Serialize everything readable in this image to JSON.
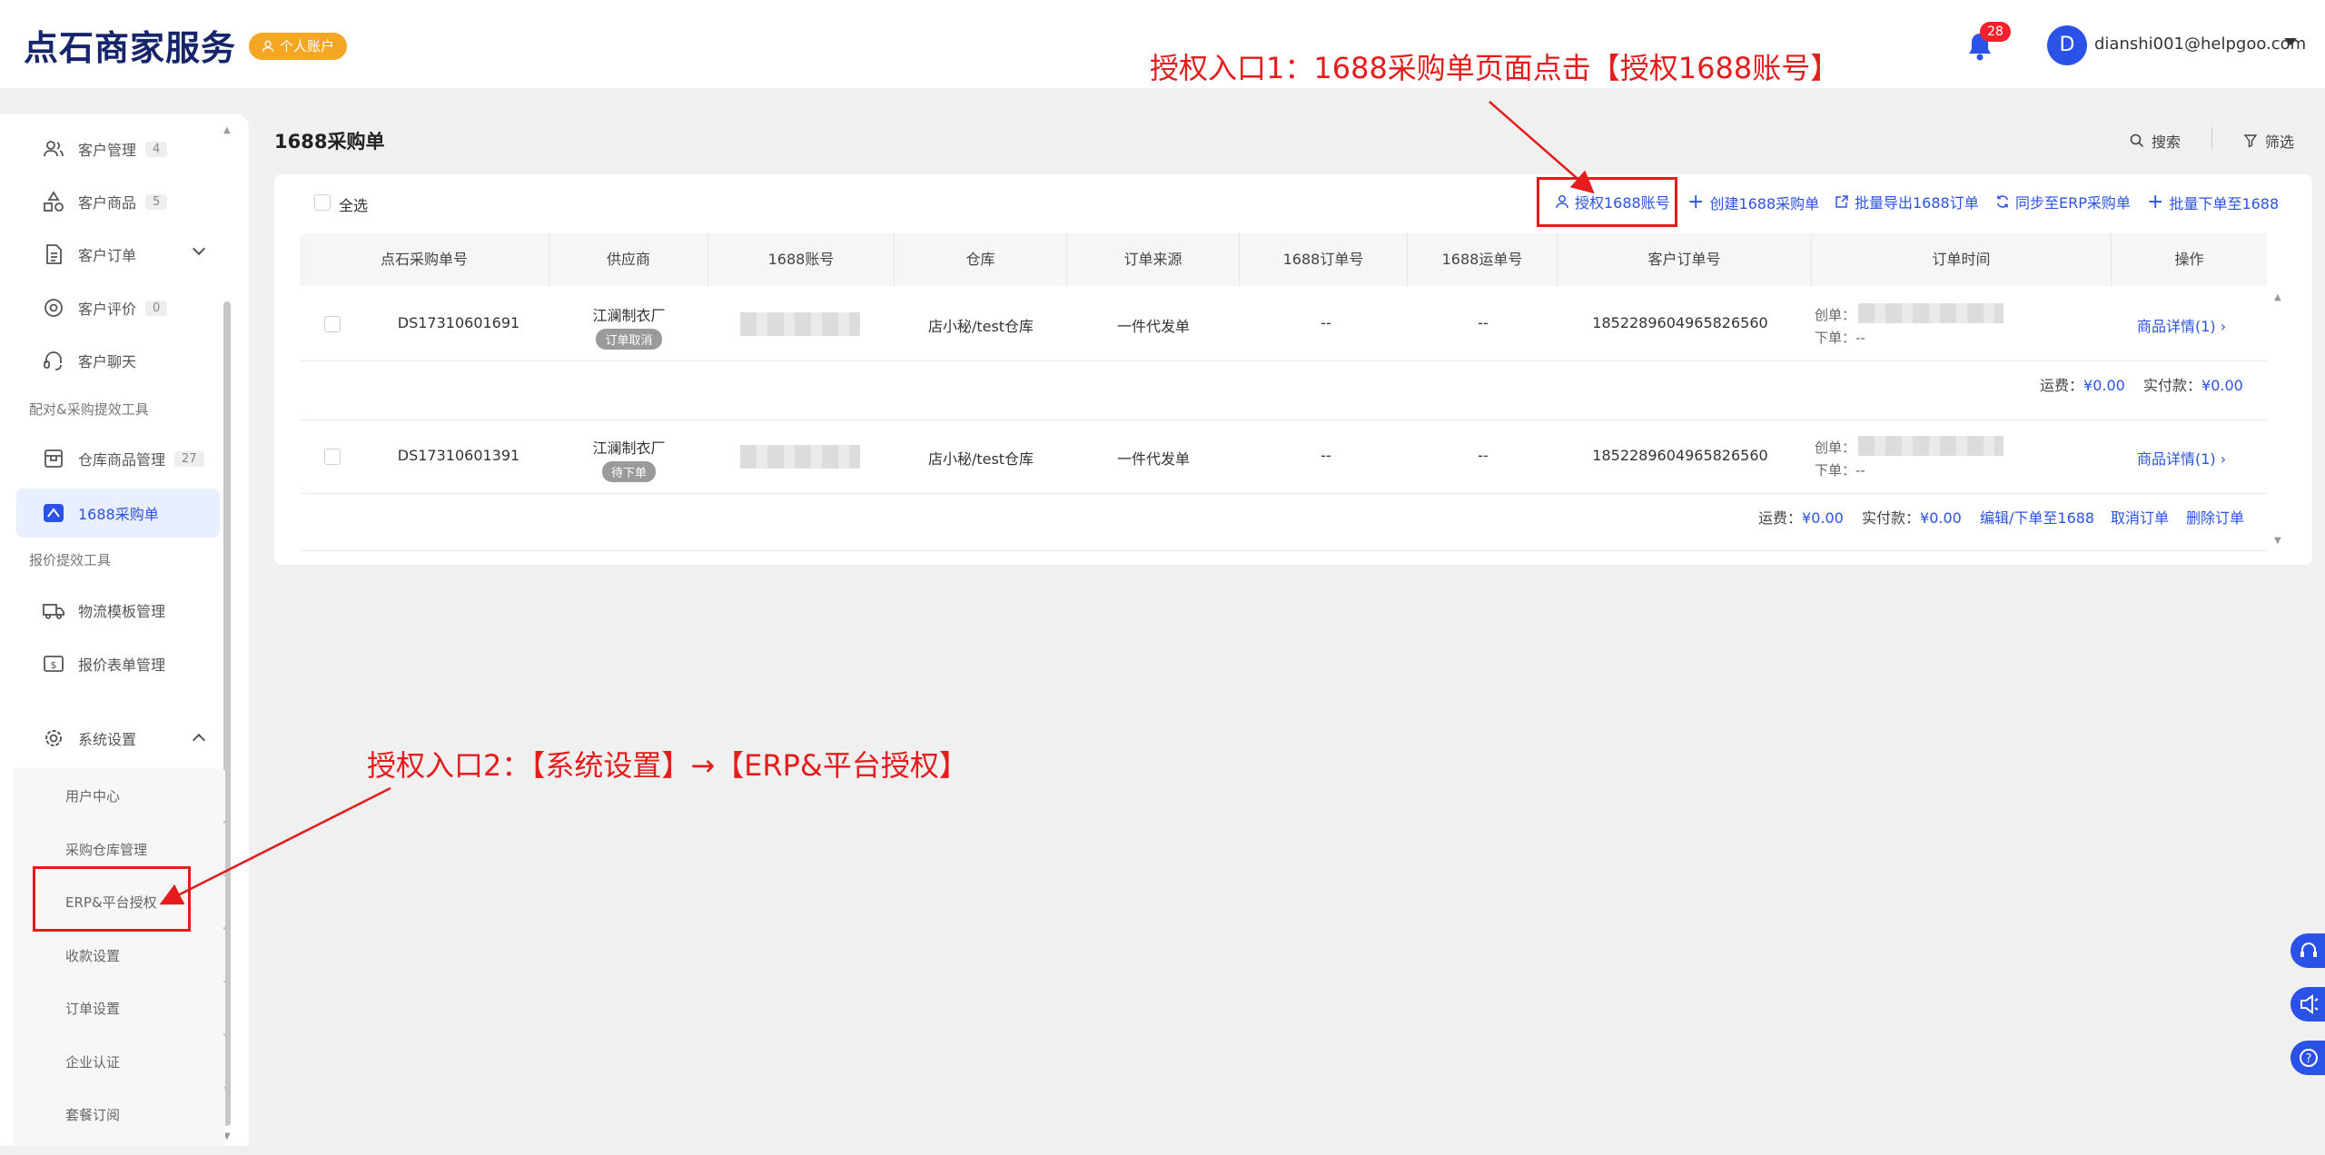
{
  "header": {
    "logo": "点石商家服务",
    "account_badge": "个人账户",
    "notification_count": "28",
    "avatar_letter": "D",
    "user_email": "dianshi001@helpgoo.com"
  },
  "sidebar": {
    "items": [
      {
        "label": "客户管理",
        "count": "4"
      },
      {
        "label": "客户商品",
        "count": "5"
      },
      {
        "label": "客户订单"
      },
      {
        "label": "客户评价",
        "count": "0"
      },
      {
        "label": "客户聊天"
      }
    ],
    "section1": "配对&采购提效工具",
    "section1_items": [
      {
        "label": "仓库商品管理",
        "count": "27"
      },
      {
        "label": "1688采购单"
      }
    ],
    "section2": "报价提效工具",
    "section2_items": [
      {
        "label": "物流模板管理"
      },
      {
        "label": "报价表单管理"
      }
    ],
    "settings": "系统设置",
    "settings_sub": [
      "用户中心",
      "采购仓库管理",
      "ERP&平台授权",
      "收款设置",
      "订单设置",
      "企业认证",
      "套餐订阅"
    ]
  },
  "main": {
    "title": "1688采购单",
    "search_label": "搜索",
    "filter_label": "筛选",
    "select_all": "全选",
    "actions": [
      "授权1688账号",
      "创建1688采购单",
      "批量导出1688订单",
      "同步至ERP采购单",
      "批量下单至1688"
    ],
    "columns": [
      "点石采购单号",
      "供应商",
      "1688账号",
      "仓库",
      "订单来源",
      "1688订单号",
      "1688运单号",
      "客户订单号",
      "订单时间",
      "操作"
    ],
    "rows": [
      {
        "order_no": "DS17310601691",
        "supplier": "江澜制衣厂",
        "status": "订单取消",
        "warehouse": "店小秘/test仓库",
        "source": "一件代发单",
        "order_1688": "--",
        "waybill": "--",
        "customer_order": "1852289604965826560",
        "created_label": "创单：",
        "placed_label": "下单：",
        "placed_value": "--",
        "detail_link": "商品详情(1)",
        "freight_label": "运费：",
        "freight": "¥0.00",
        "paid_label": "实付款：",
        "paid": "¥0.00"
      },
      {
        "order_no": "DS17310601391",
        "supplier": "江澜制衣厂",
        "status": "待下单",
        "warehouse": "店小秘/test仓库",
        "source": "一件代发单",
        "order_1688": "--",
        "waybill": "--",
        "customer_order": "1852289604965826560",
        "created_label": "创单：",
        "placed_label": "下单：",
        "placed_value": "--",
        "detail_link": "商品详情(1)",
        "freight_label": "运费：",
        "freight": "¥0.00",
        "paid_label": "实付款：",
        "paid": "¥0.00",
        "row_actions": [
          "编辑/下单至1688",
          "取消订单",
          "删除订单"
        ]
      }
    ]
  },
  "annotations": {
    "entry1": "授权入口1：1688采购单页面点击【授权1688账号】",
    "entry2": "授权入口2：【系统设置】→【ERP&平台授权】"
  },
  "colors": {
    "accent": "#2a52e6",
    "annotation": "#e51c1c",
    "badge": "#f5a623"
  }
}
